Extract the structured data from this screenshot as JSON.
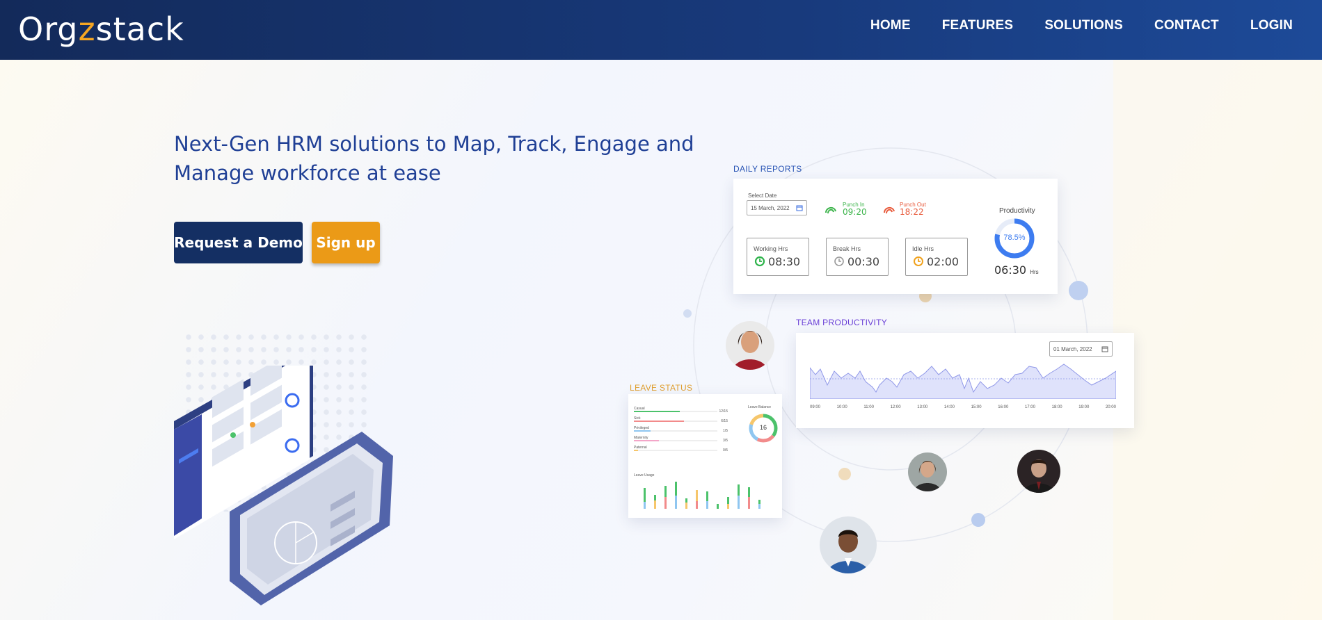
{
  "brand": {
    "logo_text_a": "Org",
    "logo_text_b": "z",
    "logo_text_c": "stack"
  },
  "nav": {
    "items": [
      "HOME",
      "FEATURES",
      "SOLUTIONS",
      "CONTACT",
      "LOGIN"
    ]
  },
  "hero": {
    "headline_line1": "Next-Gen HRM solutions to Map, Track, Engage and",
    "headline_line2": "Manage workforce at ease",
    "demo_button": "Request a Demo",
    "signup_button": "Sign up"
  },
  "daily_reports": {
    "label": "DAILY REPORTS",
    "select_date_label": "Select Date",
    "date": "15 March, 2022",
    "punch_in_label": "Punch In",
    "punch_in": "09:20",
    "punch_out_label": "Punch Out",
    "punch_out": "18:22",
    "working_label": "Working Hrs",
    "working": "08:30",
    "break_label": "Break Hrs",
    "break": "00:30",
    "idle_label": "Idle Hrs",
    "idle": "02:00",
    "productivity_label": "Productivity",
    "productivity_pct": "78.5%",
    "productivity_value": 78.5,
    "productivity_hours": "06:30",
    "hours_unit": "Hrs"
  },
  "team_productivity": {
    "label": "TEAM PRODUCTIVITY",
    "date": "01 March, 2022",
    "x_labels": [
      "09:00",
      "10:00",
      "11:00",
      "12:00",
      "13:00",
      "14:00",
      "15:00",
      "16:00",
      "17:00",
      "18:00",
      "19:00",
      "20:00"
    ]
  },
  "leave_status": {
    "label": "LEAVE STATUS",
    "rows": [
      {
        "name": "Casual",
        "value": "12/15"
      },
      {
        "name": "Sick",
        "value": "6/15"
      },
      {
        "name": "Privileged",
        "value": "1/5"
      },
      {
        "name": "Maternity",
        "value": "3/5"
      },
      {
        "name": "Paternal",
        "value": "0/5"
      }
    ],
    "balance_label": "Leave Balance",
    "balance_value": "16",
    "usage_label": "Leave Usage"
  },
  "colors": {
    "navy": "#142f63",
    "orange": "#eb9a17",
    "blue": "#1f3f95",
    "purple": "#6a3fd6",
    "gold": "#e0a030"
  }
}
